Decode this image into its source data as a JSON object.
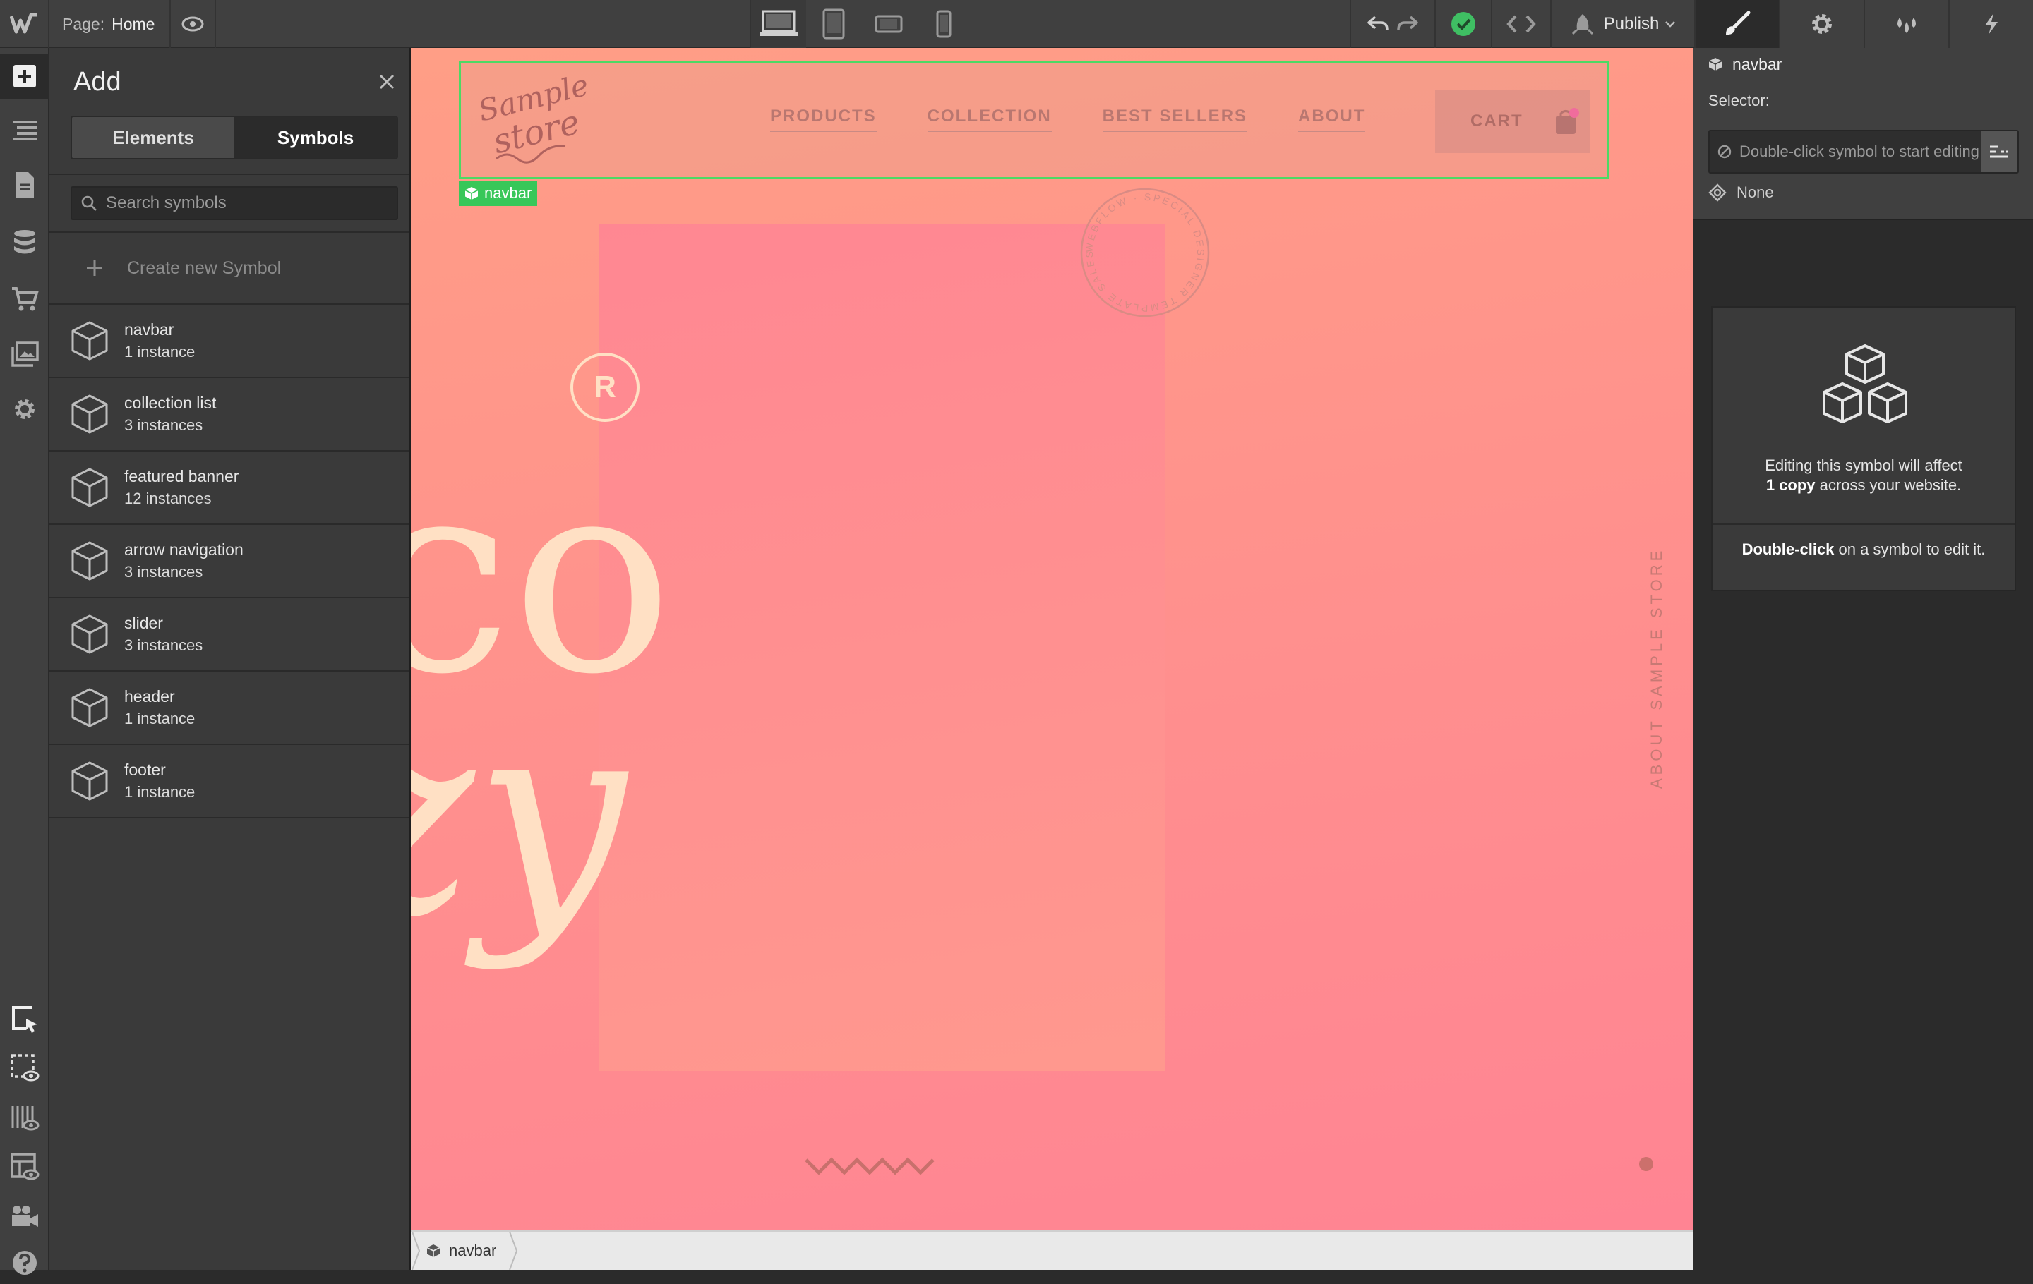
{
  "topbar": {
    "page_label": "Page:",
    "page_name": "Home",
    "publish_label": "Publish"
  },
  "add_panel": {
    "title": "Add",
    "tab_elements": "Elements",
    "tab_symbols": "Symbols",
    "search_placeholder": "Search symbols",
    "create_label": "Create new Symbol",
    "symbols": [
      {
        "name": "navbar",
        "count": "1 instance"
      },
      {
        "name": "collection list",
        "count": "3 instances"
      },
      {
        "name": "featured banner",
        "count": "12 instances"
      },
      {
        "name": "arrow navigation",
        "count": "3 instances"
      },
      {
        "name": "slider",
        "count": "3 instances"
      },
      {
        "name": "header",
        "count": "1 instance"
      },
      {
        "name": "footer",
        "count": "1 instance"
      }
    ]
  },
  "canvas": {
    "logo_line1": "Sample",
    "logo_line2": "store",
    "nav_links": [
      "PRODUCTS",
      "COLLECTION",
      "BEST SELLERS",
      "ABOUT"
    ],
    "cart_label": "CART",
    "selected_tag": "navbar",
    "stamp_text": "WEBFLOW · SPECIAL DESIGNER TEMPLATE SALES ·",
    "registered_mark": "R",
    "big_letters_top": "co",
    "big_letters_bottom": "zy",
    "vertical_text": "ABOUT SAMPLE STORE"
  },
  "breadcrumb": {
    "item": "navbar"
  },
  "right_panel": {
    "selected_name": "navbar",
    "selector_label": "Selector:",
    "selector_placeholder": "Double-click symbol to start editing",
    "none_label": "None",
    "info_line1": "Editing this symbol will affect",
    "info_bold": "1 copy",
    "info_line2_rest": " across your website.",
    "hint_bold": "Double-click",
    "hint_rest": " on a symbol to edit it."
  },
  "colors": {
    "selection_green": "#4cd964",
    "canvas_pink": "#ff8f8e",
    "panel_dark": "#2b2b2b"
  }
}
